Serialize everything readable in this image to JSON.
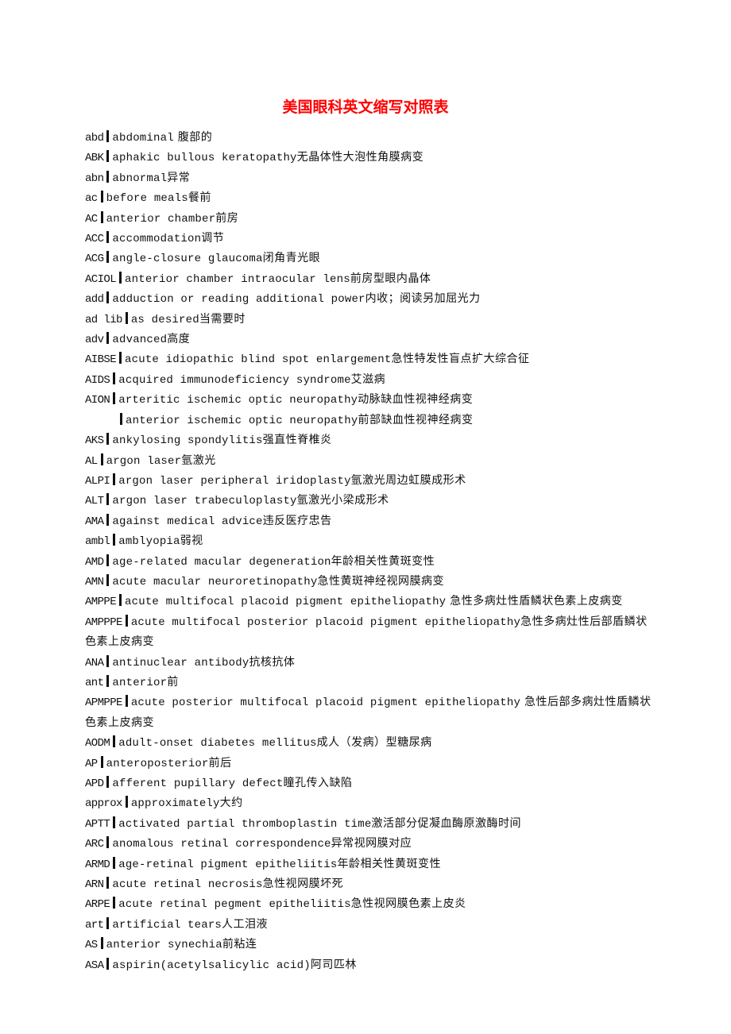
{
  "title": "美国眼科英文缩写对照表",
  "title_color": "#ff0000",
  "entries": [
    {
      "abbr": "abd",
      "en": "abdominal",
      "zh": " 腹部的"
    },
    {
      "abbr": "ABK",
      "en": "aphakic bullous keratopathy",
      "zh": "无晶体性大泡性角膜病变"
    },
    {
      "abbr": "abn",
      "en": "abnormal",
      "zh": "异常"
    },
    {
      "abbr": "ac",
      "en": "before meals",
      "zh": "餐前"
    },
    {
      "abbr": "AC",
      "en": "anterior chamber",
      "zh": "前房"
    },
    {
      "abbr": "ACC",
      "en": "accommodation",
      "zh": "调节"
    },
    {
      "abbr": "ACG",
      "en": "angle-closure glaucoma",
      "zh": "闭角青光眼"
    },
    {
      "abbr": "ACIOL",
      "en": "anterior chamber intraocular lens",
      "zh": "前房型眼内晶体"
    },
    {
      "abbr": "add",
      "en": "adduction or reading additional power",
      "zh": "内收；阅读另加屈光力"
    },
    {
      "abbr": "ad lib",
      "en": "as desired",
      "zh": "当需要时"
    },
    {
      "abbr": "adv",
      "en": "advanced",
      "zh": "高度"
    },
    {
      "abbr": "AIBSE",
      "en": "acute idiopathic blind spot enlargement",
      "zh": "急性特发性盲点扩大综合征"
    },
    {
      "abbr": "AIDS",
      "en": "acquired immunodeficiency syndrome",
      "zh": "艾滋病"
    },
    {
      "abbr": "AION",
      "en": "arteritic ischemic optic neuropathy",
      "zh": "动脉缺血性视神经病变"
    },
    {
      "abbr": "",
      "en": "anterior ischemic optic neuropathy",
      "zh": "前部缺血性视神经病变",
      "continuation": true
    },
    {
      "abbr": "AKS",
      "en": "ankylosing spondylitis",
      "zh": "强直性脊椎炎"
    },
    {
      "abbr": "AL",
      "en": "argon laser",
      "zh": "氩激光"
    },
    {
      "abbr": "ALPI",
      "en": "argon laser peripheral iridoplasty",
      "zh": "氩激光周边虹膜成形术"
    },
    {
      "abbr": "ALT",
      "en": "argon laser trabeculoplasty",
      "zh": "氩激光小梁成形术"
    },
    {
      "abbr": "AMA",
      "en": "against medical advice",
      "zh": "违反医疗忠告"
    },
    {
      "abbr": "ambl",
      "en": "amblyopia",
      "zh": "弱视"
    },
    {
      "abbr": "AMD",
      "en": "age-related macular degeneration",
      "zh": "年龄相关性黄斑变性"
    },
    {
      "abbr": "AMN",
      "en": "acute macular neuroretinopathy",
      "zh": "急性黄斑神经视网膜病变"
    },
    {
      "abbr": "AMPPE",
      "en": "acute multifocal placoid pigment epitheliopathy",
      "zh": " 急性多病灶性盾鳞状色素上皮病变"
    },
    {
      "abbr": "AMPPPE",
      "en": "acute multifocal posterior placoid pigment epitheliopathy",
      "zh": "急性多病灶性后部盾鳞状色素上皮病变"
    },
    {
      "abbr": "ANA",
      "en": "antinuclear antibody",
      "zh": "抗核抗体"
    },
    {
      "abbr": "ant",
      "en": "anterior",
      "zh": "前"
    },
    {
      "abbr": "APMPPE",
      "en": "acute posterior multifocal placoid pigment epitheliopathy",
      "zh": " 急性后部多病灶性盾鳞状色素上皮病变"
    },
    {
      "abbr": "AODM",
      "en": "adult-onset diabetes mellitus",
      "zh": "成人（发病）型糖尿病"
    },
    {
      "abbr": "AP",
      "en": "anteroposterior",
      "zh": "前后"
    },
    {
      "abbr": "APD",
      "en": "afferent pupillary defect",
      "zh": "瞳孔传入缺陷"
    },
    {
      "abbr": "approx",
      "en": "approximately",
      "zh": "大约"
    },
    {
      "abbr": "APTT",
      "en": "activated partial thromboplastin time",
      "zh": "激活部分促凝血酶原激酶时间"
    },
    {
      "abbr": "ARC",
      "en": "anomalous retinal correspondence",
      "zh": "异常视网膜对应"
    },
    {
      "abbr": "ARMD",
      "en": "age-retinal pigment epitheliitis",
      "zh": "年龄相关性黄斑变性"
    },
    {
      "abbr": "ARN",
      "en": "acute retinal necrosis",
      "zh": "急性视网膜坏死"
    },
    {
      "abbr": "ARPE",
      "en": "acute retinal pegment epitheliitis",
      "zh": "急性视网膜色素上皮炎"
    },
    {
      "abbr": "art",
      "en": "artificial tears",
      "zh": "人工泪液"
    },
    {
      "abbr": "AS",
      "en": "anterior synechia",
      "zh": "前粘连"
    },
    {
      "abbr": "ASA",
      "en": "aspirin(acetylsalicylic acid)",
      "zh": "阿司匹林"
    }
  ]
}
